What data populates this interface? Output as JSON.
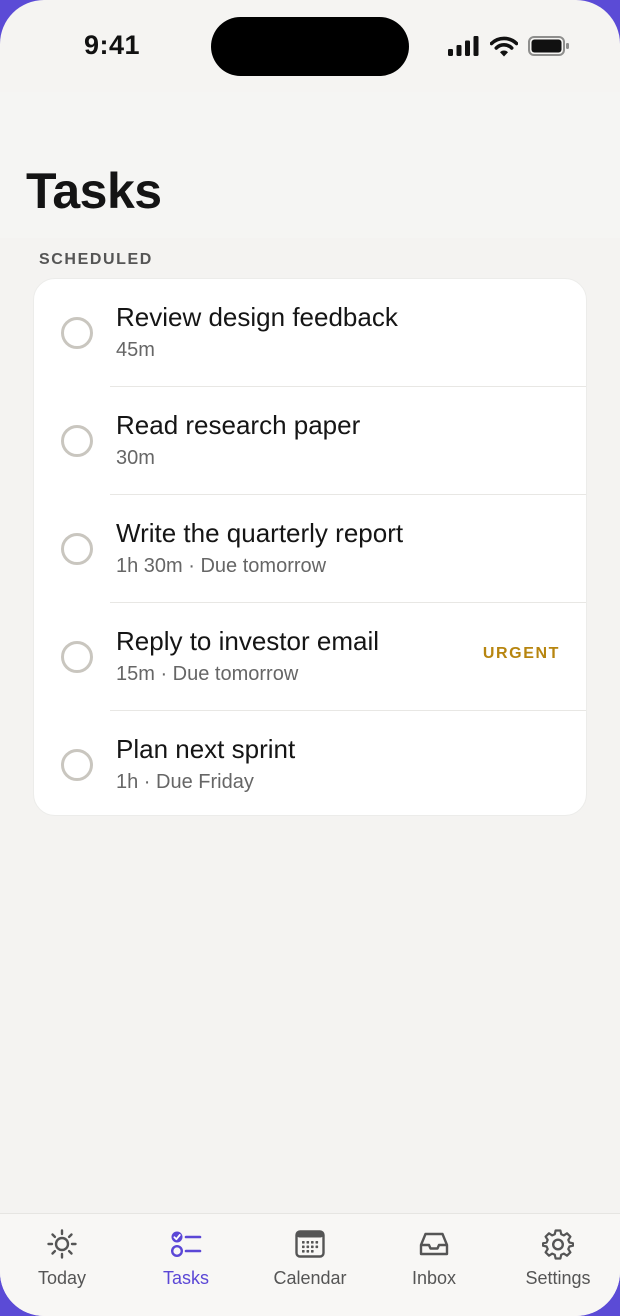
{
  "status_bar": {
    "time": "9:41"
  },
  "header": {
    "title": "Tasks"
  },
  "section": {
    "label": "SCHEDULED"
  },
  "tasks": [
    {
      "title": "Review design feedback",
      "meta": "45m",
      "badge": ""
    },
    {
      "title": "Read research paper",
      "meta": "30m",
      "badge": ""
    },
    {
      "title": "Write the quarterly report",
      "meta": "1h 30m · Due tomorrow",
      "badge": ""
    },
    {
      "title": "Reply to investor email",
      "meta": "15m · Due tomorrow",
      "badge": "URGENT"
    },
    {
      "title": "Plan next sprint",
      "meta": "1h · Due Friday",
      "badge": ""
    }
  ],
  "tab_bar": {
    "tabs": [
      {
        "label": "Today",
        "icon": "sun-icon",
        "active": false
      },
      {
        "label": "Tasks",
        "icon": "checklist-icon",
        "active": true
      },
      {
        "label": "Calendar",
        "icon": "calendar-icon",
        "active": false
      },
      {
        "label": "Inbox",
        "icon": "inbox-icon",
        "active": false
      },
      {
        "label": "Settings",
        "icon": "gear-icon",
        "active": false
      }
    ]
  },
  "colors": {
    "accent": "#5b47d6",
    "urgent": "#b7850f",
    "background": "#f4f3f1",
    "card": "#ffffff",
    "frame": "#5b4bd6"
  }
}
